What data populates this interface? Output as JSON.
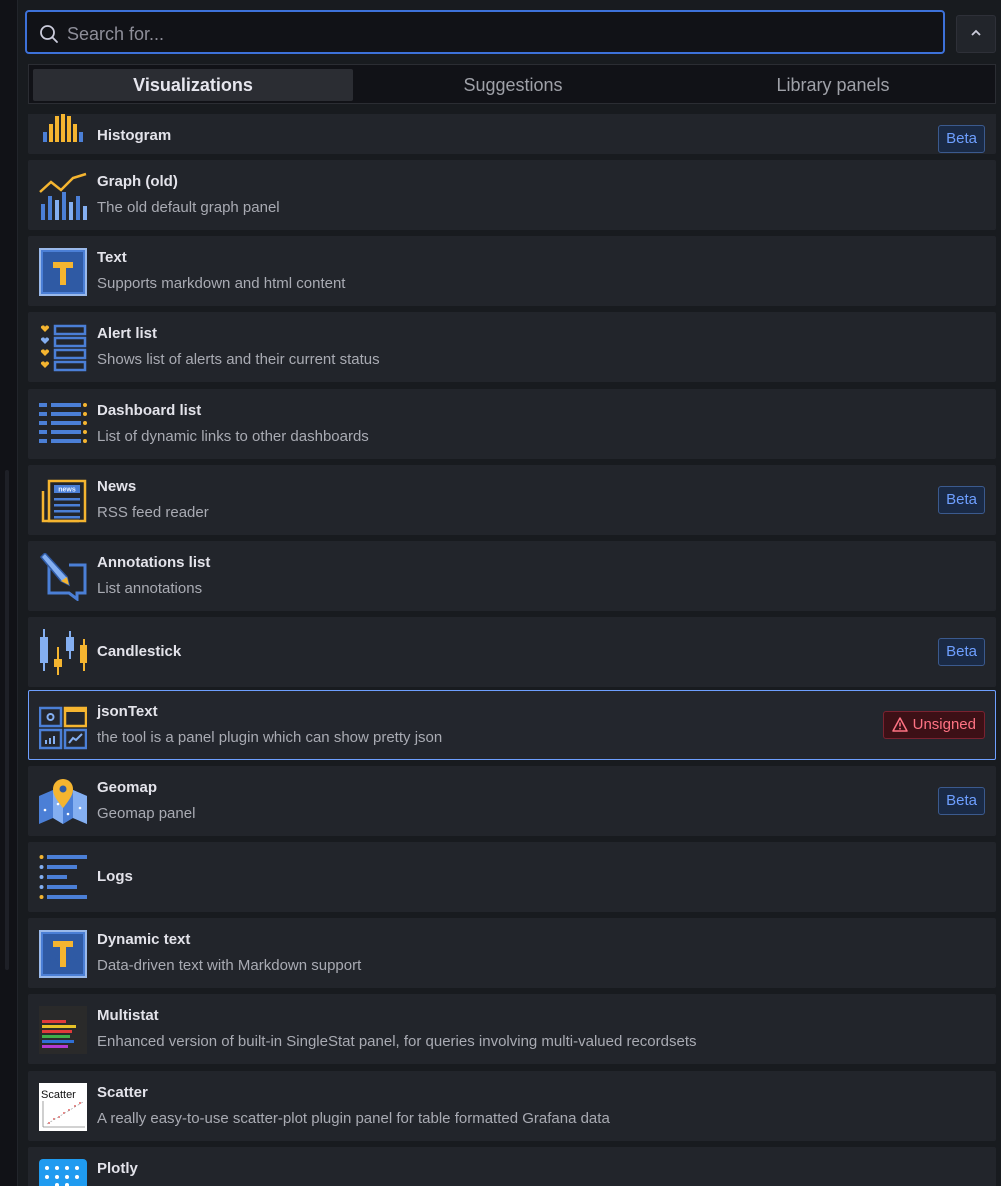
{
  "search": {
    "placeholder": "Search for...",
    "value": ""
  },
  "tabs": [
    {
      "label": "Visualizations",
      "active": true
    },
    {
      "label": "Suggestions",
      "active": false
    },
    {
      "label": "Library panels",
      "active": false
    }
  ],
  "items": [
    {
      "title": "Histogram",
      "description": "",
      "badge": "Beta",
      "icon": "histogram-icon"
    },
    {
      "title": "Graph (old)",
      "description": "The old default graph panel",
      "badge": "",
      "icon": "graph-icon"
    },
    {
      "title": "Text",
      "description": "Supports markdown and html content",
      "badge": "",
      "icon": "text-icon"
    },
    {
      "title": "Alert list",
      "description": "Shows list of alerts and their current status",
      "badge": "",
      "icon": "alert-list-icon"
    },
    {
      "title": "Dashboard list",
      "description": "List of dynamic links to other dashboards",
      "badge": "",
      "icon": "dashboard-list-icon"
    },
    {
      "title": "News",
      "description": "RSS feed reader",
      "badge": "Beta",
      "icon": "news-icon"
    },
    {
      "title": "Annotations list",
      "description": "List annotations",
      "badge": "",
      "icon": "annotations-list-icon"
    },
    {
      "title": "Candlestick",
      "description": "",
      "badge": "Beta",
      "icon": "candlestick-icon"
    },
    {
      "title": "jsonText",
      "description": "the tool is a panel plugin which can show pretty json",
      "badge": "Unsigned",
      "icon": "json-text-icon"
    },
    {
      "title": "Geomap",
      "description": "Geomap panel",
      "badge": "Beta",
      "icon": "geomap-icon"
    },
    {
      "title": "Logs",
      "description": "",
      "badge": "",
      "icon": "logs-icon"
    },
    {
      "title": "Dynamic text",
      "description": "Data-driven text with Markdown support",
      "badge": "",
      "icon": "dynamic-text-icon"
    },
    {
      "title": "Multistat",
      "description": "Enhanced version of built-in SingleStat panel, for queries involving multi-valued recordsets",
      "badge": "",
      "icon": "multistat-icon"
    },
    {
      "title": "Scatter",
      "description": "A really easy-to-use scatter-plot plugin panel for table formatted Grafana data",
      "badge": "",
      "icon": "scatter-icon",
      "logo_text": "Scatter"
    },
    {
      "title": "Plotly",
      "description": "",
      "badge": "",
      "icon": "plotly-icon"
    }
  ],
  "colors": {
    "accent": "#3d71d9",
    "badge_beta": "#6e9fff",
    "badge_unsigned": "#ff7383",
    "icon_blue": "#4b7fd6",
    "icon_yellow": "#f5b530"
  }
}
